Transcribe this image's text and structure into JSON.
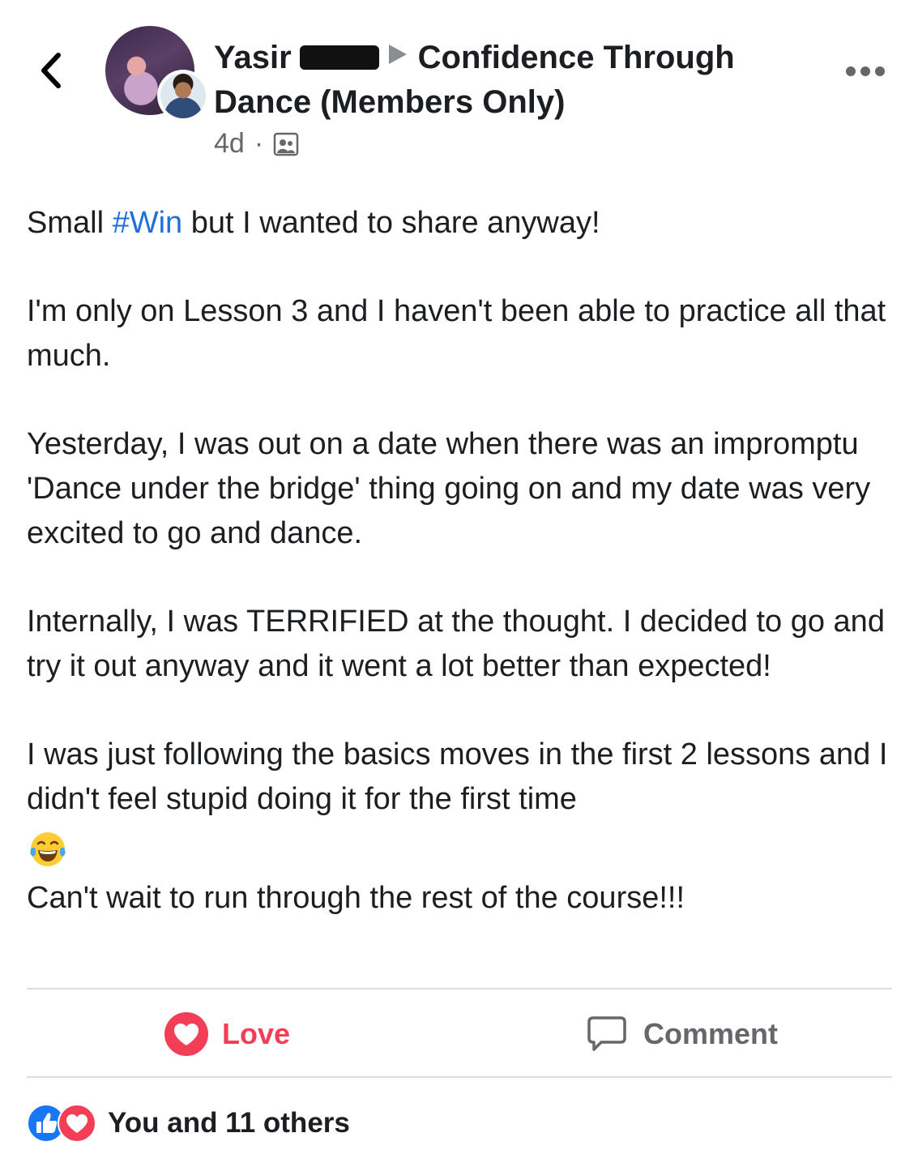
{
  "post": {
    "author_name": "Yasir",
    "group_name_line1": "Confidence Through",
    "group_name_line2": "Dance (Members Only)",
    "timestamp": "4d",
    "meta_separator": "·",
    "audience_icon": "group-members-icon",
    "paragraphs": {
      "p1_before": "Small ",
      "p1_hashtag": "#Win",
      "p1_after": " but I wanted to share anyway!",
      "p2": "I'm only on Lesson 3 and I haven't been able to practice all that much.",
      "p3": "Yesterday, I was out on a date when there was an impromptu 'Dance under the bridge' thing going on and my date was very excited to go and dance.",
      "p4": "Internally, I was TERRIFIED at the thought. I decided to go and try it out anyway and it went a lot better than expected!",
      "p5": "I was just following the basics moves in the first 2 lessons and I didn't feel stupid doing it for the first time",
      "emoji": "tears-of-joy-emoji",
      "p6": "Can't wait to run through the rest of the course!!!"
    }
  },
  "actions": {
    "love_label": "Love",
    "comment_label": "Comment"
  },
  "reactions": {
    "summary": "You and 11 others",
    "icons": [
      "like-icon",
      "love-icon"
    ]
  },
  "colors": {
    "love": "#f33e58",
    "like": "#1877f2",
    "hashtag": "#216fdb",
    "secondary_text": "#65676b",
    "divider": "#dadde1"
  }
}
